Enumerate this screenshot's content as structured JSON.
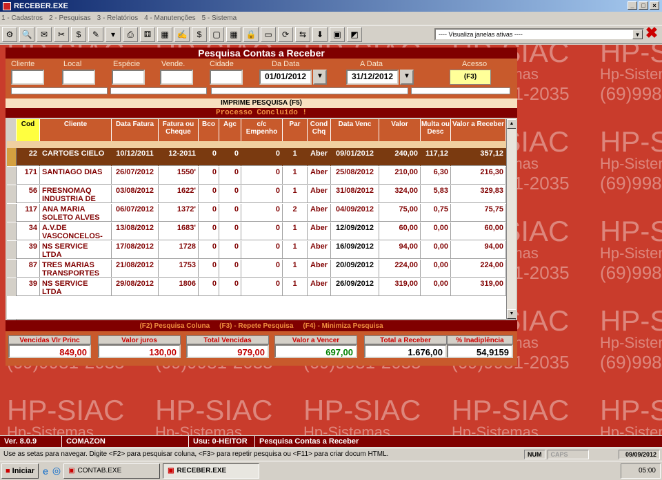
{
  "window": {
    "title": "RECEBER.EXE"
  },
  "menu": [
    "1 - Cadastros",
    "2 - Pesquisas",
    "3 - Relatórios",
    "4 - Manutenções",
    "5 - Sistema"
  ],
  "toolbar": {
    "icons": [
      "gears-icon",
      "search-icon",
      "cheque-icon",
      "tools-icon",
      "money-icon",
      "cheque-deposit-icon",
      "dropdown-icon",
      "printer-icon",
      "dice-icon",
      "calculator-grid-icon",
      "cheque-search-icon",
      "finance-icon",
      "window-icon",
      "calculator-icon",
      "lock-icon",
      "screen-icon",
      "refresh-icon",
      "transfer-icon",
      "download-icon",
      "window-close-icon",
      "window-arrow-icon"
    ],
    "window_select": "---- Visualiza janelas ativas ----"
  },
  "watermark": {
    "brand": "HP-SIAC",
    "company": "Hp-Sistemas",
    "phone": "(69)9981-2035"
  },
  "panel": {
    "title": "Pesquisa Contas a Receber",
    "filters": {
      "cliente_label": "Cliente",
      "local_label": "Local",
      "especie_label": "Espécie",
      "vende_label": "Vende.",
      "cidade_label": "Cidade",
      "da_data_label": "Da Data",
      "a_data_label": "A Data",
      "acesso_label": "Acesso",
      "da_data": "01/01/2012",
      "a_data": "31/12/2012",
      "acesso_key": "(F3)"
    },
    "imprime": "IMPRIME PESQUISA (F5)",
    "processo": "Processo Concluido !",
    "columns": [
      "Cod",
      "Cliente",
      "Data Fatura",
      "Fatura ou Cheque",
      "Bco",
      "Agc",
      "c/c Empenho",
      "Par",
      "Cond Chq",
      "Data Venc",
      "Valor",
      "Multa ou Desc",
      "Valor a Receber"
    ],
    "rows": [
      {
        "cod": "22",
        "cliente": "CARTOES CIELO",
        "data_fatura": "10/12/2011",
        "fatura": "12-2011",
        "bco": "0",
        "agc": "0",
        "cc": "0",
        "par": "1",
        "cond": "Aber",
        "venc": "09/01/2012",
        "valor": "240,00",
        "multa": "117,12",
        "receber": "357,12"
      },
      {
        "cod": "171",
        "cliente": "SANTIAGO DIAS",
        "data_fatura": "26/07/2012",
        "fatura": "1550'",
        "bco": "0",
        "agc": "0",
        "cc": "0",
        "par": "1",
        "cond": "Aber",
        "venc": "25/08/2012",
        "valor": "210,00",
        "multa": "6,30",
        "receber": "216,30"
      },
      {
        "cod": "56",
        "cliente": "FRESNOMAQ INDUSTRIA DE",
        "data_fatura": "03/08/2012",
        "fatura": "1622'",
        "bco": "0",
        "agc": "0",
        "cc": "0",
        "par": "1",
        "cond": "Aber",
        "venc": "31/08/2012",
        "valor": "324,00",
        "multa": "5,83",
        "receber": "329,83"
      },
      {
        "cod": "117",
        "cliente": "ANA MARIA SOLETO ALVES",
        "data_fatura": "06/07/2012",
        "fatura": "1372'",
        "bco": "0",
        "agc": "0",
        "cc": "0",
        "par": "2",
        "cond": "Aber",
        "venc": "04/09/2012",
        "valor": "75,00",
        "multa": "0,75",
        "receber": "75,75"
      },
      {
        "cod": "34",
        "cliente": "A.V.DE VASCONCELOS-ME",
        "data_fatura": "13/08/2012",
        "fatura": "1683'",
        "bco": "0",
        "agc": "0",
        "cc": "0",
        "par": "1",
        "cond": "Aber",
        "venc": "12/09/2012",
        "valor": "60,00",
        "multa": "0,00",
        "receber": "60,00"
      },
      {
        "cod": "39",
        "cliente": "NS SERVICE LTDA",
        "data_fatura": "17/08/2012",
        "fatura": "1728",
        "bco": "0",
        "agc": "0",
        "cc": "0",
        "par": "1",
        "cond": "Aber",
        "venc": "16/09/2012",
        "valor": "94,00",
        "multa": "0,00",
        "receber": "94,00"
      },
      {
        "cod": "87",
        "cliente": "TRES MARIAS TRANSPORTES",
        "data_fatura": "21/08/2012",
        "fatura": "1753",
        "bco": "0",
        "agc": "0",
        "cc": "0",
        "par": "1",
        "cond": "Aber",
        "venc": "20/09/2012",
        "valor": "224,00",
        "multa": "0,00",
        "receber": "224,00"
      },
      {
        "cod": "39",
        "cliente": "NS SERVICE LTDA",
        "data_fatura": "29/08/2012",
        "fatura": "1806",
        "bco": "0",
        "agc": "0",
        "cc": "0",
        "par": "1",
        "cond": "Aber",
        "venc": "26/09/2012",
        "valor": "319,00",
        "multa": "0,00",
        "receber": "319,00"
      }
    ],
    "fkeys": [
      "(F2) Pesquisa Coluna",
      "(F3) - Repete Pesquisa",
      "(F4) - Minimiza Pesquisa"
    ],
    "totals": [
      {
        "label": "Vencidas Vlr Princ",
        "value": "849,00",
        "color": "#c00000"
      },
      {
        "label": "Valor juros",
        "value": "130,00",
        "color": "#c00000"
      },
      {
        "label": "Total Vencidas",
        "value": "979,00",
        "color": "#c00000"
      },
      {
        "label": "Valor a Vencer",
        "value": "697,00",
        "color": "#008000"
      },
      {
        "label": "Total a Receber",
        "value": "1.676,00",
        "color": "#000000"
      },
      {
        "label": "% Inadiplência",
        "value": "54,9159",
        "color": "#000000"
      }
    ]
  },
  "status": {
    "version": "Ver. 8.0.9",
    "company": "COMAZON",
    "user": "Usu: 0-HEITOR",
    "screen": "Pesquisa Contas a Receber"
  },
  "hint": {
    "text": "Use as setas para navegar. Digite <F2> para pesquisar coluna, <F3> para repetir pesquisa ou <F11> para criar docum HTML.",
    "num": "NUM",
    "caps": "CAPS",
    "date": "09/09/2012"
  },
  "taskbar": {
    "start": "Iniciar",
    "items": [
      "CONTAB.EXE",
      "RECEBER.EXE"
    ],
    "clock": "05:00"
  }
}
